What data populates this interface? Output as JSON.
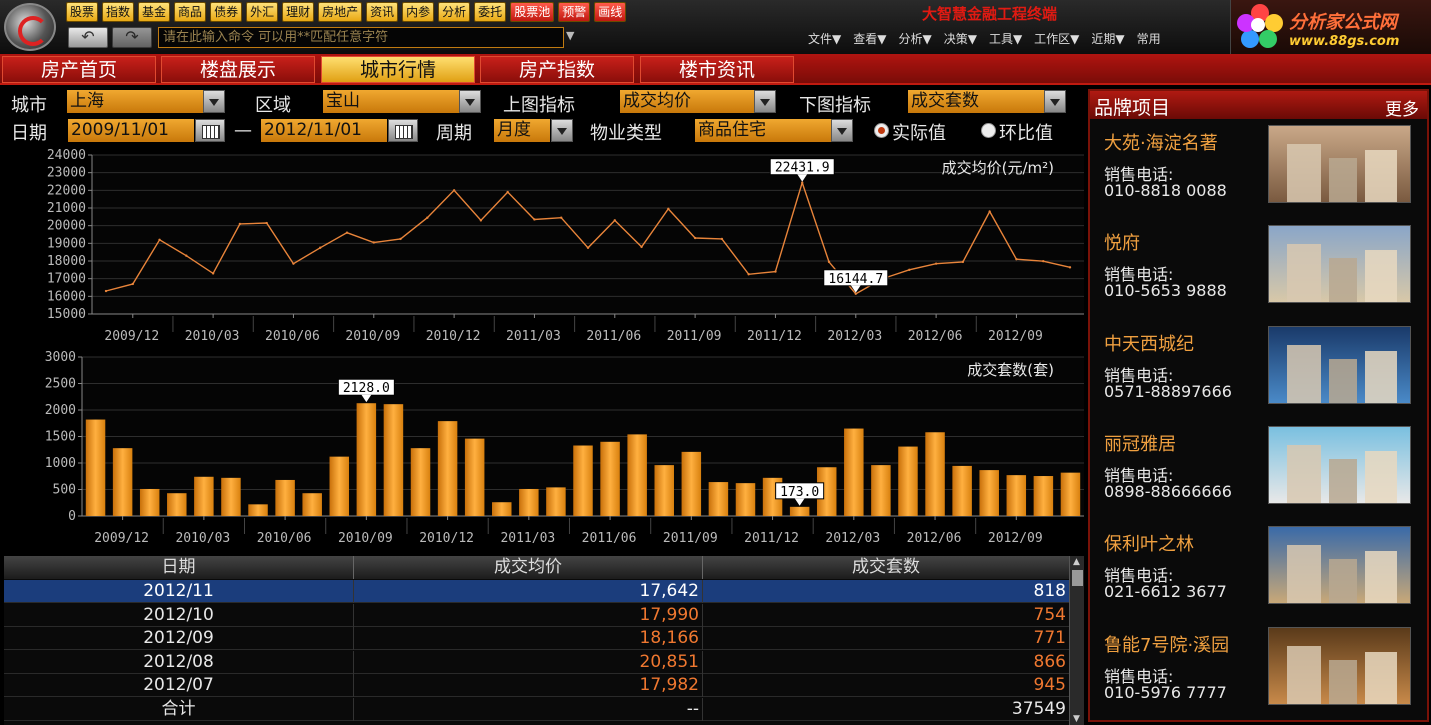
{
  "top_buttons": [
    "股票",
    "指数",
    "基金",
    "商品",
    "债券",
    "外汇",
    "理财",
    "房地产",
    "资讯",
    "内参",
    "分析",
    "委托",
    "股票池",
    "预警",
    "画线"
  ],
  "top_buttons_red": [
    12,
    13,
    14
  ],
  "app_title": "大智慧金融工程终端",
  "command": {
    "value": "请在此输入命令   可以用**匹配任意字符"
  },
  "menus": [
    "文件▼",
    "查看▼",
    "分析▼",
    "决策▼",
    "工具▼",
    "工作区▼",
    "近期▼",
    "常用"
  ],
  "brand": {
    "name": "分析家公式网",
    "url": "www.88gs.com"
  },
  "tabs": [
    "房产首页",
    "楼盘展示",
    "城市行情",
    "房产指数",
    "楼市资讯"
  ],
  "active_tab": 2,
  "filters": {
    "city_label": "城市",
    "city": "上海",
    "district_label": "区域",
    "district": "宝山",
    "upper_label": "上图指标",
    "upper": "成交均价",
    "lower_label": "下图指标",
    "lower": "成交套数",
    "date_label": "日期",
    "date_from": "2009/11/01",
    "date_sep": "—",
    "date_to": "2012/11/01",
    "period_label": "周期",
    "period": "月度",
    "type_label": "物业类型",
    "type": "商品住宅",
    "radio_actual": "实际值",
    "radio_mom": "环比值"
  },
  "chart_data": [
    {
      "type": "line",
      "title": "成交均价(元/m²)",
      "ylim": [
        15000,
        24000
      ],
      "yticks": [
        15000,
        16000,
        17000,
        18000,
        19000,
        20000,
        21000,
        22000,
        23000,
        24000
      ],
      "xticks": [
        "2009/12",
        "2010/03",
        "2010/06",
        "2010/09",
        "2010/12",
        "2011/03",
        "2011/06",
        "2011/09",
        "2011/12",
        "2012/03",
        "2012/06",
        "2012/09"
      ],
      "values": [
        16300,
        16700,
        19200,
        18300,
        17300,
        20100,
        20150,
        17850,
        18750,
        19600,
        19050,
        19250,
        20450,
        22000,
        20300,
        21900,
        20350,
        20450,
        18750,
        20300,
        18800,
        20950,
        19300,
        19250,
        17250,
        17400,
        22431.9,
        17950,
        16144.7,
        17000,
        17500,
        17850,
        17950,
        20800,
        18100,
        17990,
        17642
      ],
      "annotations": [
        {
          "index": 26,
          "label": "22431.9"
        },
        {
          "index": 28,
          "label": "16144.7"
        }
      ],
      "color": "#e8843a"
    },
    {
      "type": "bar",
      "title": "成交套数(套)",
      "ylim": [
        0,
        3000
      ],
      "yticks": [
        0,
        500,
        1000,
        1500,
        2000,
        2500,
        3000
      ],
      "xticks": [
        "2009/12",
        "2010/03",
        "2010/06",
        "2010/09",
        "2010/12",
        "2011/03",
        "2011/06",
        "2011/09",
        "2011/12",
        "2012/03",
        "2012/06",
        "2012/09"
      ],
      "values": [
        1820,
        1280,
        510,
        430,
        740,
        720,
        220,
        680,
        430,
        1120,
        2128,
        2110,
        1280,
        1790,
        1460,
        260,
        510,
        540,
        1330,
        1400,
        1540,
        960,
        1210,
        640,
        620,
        720,
        173,
        920,
        1650,
        960,
        1310,
        1580,
        945,
        866,
        771,
        754,
        818
      ],
      "annotations": [
        {
          "index": 10,
          "label": "2128.0"
        },
        {
          "index": 26,
          "label": "173.0"
        }
      ],
      "color": "#f0951a"
    }
  ],
  "table": {
    "headers": [
      "日期",
      "成交均价",
      "成交套数"
    ],
    "rows": [
      {
        "date": "2012/11",
        "price": "17,642",
        "count": "818"
      },
      {
        "date": "2012/10",
        "price": "17,990",
        "count": "754"
      },
      {
        "date": "2012/09",
        "price": "18,166",
        "count": "771"
      },
      {
        "date": "2012/08",
        "price": "20,851",
        "count": "866"
      },
      {
        "date": "2012/07",
        "price": "17,982",
        "count": "945"
      }
    ],
    "total": {
      "date": "合计",
      "price": "--",
      "count": "37549"
    }
  },
  "right_panel": {
    "title": "品牌项目",
    "more": "更多",
    "phone_label": "销售电话:",
    "items": [
      {
        "name": "大苑·海淀名著",
        "phone": "010-8818 0088"
      },
      {
        "name": "悦府",
        "phone": "010-5653 9888"
      },
      {
        "name": "中天西城纪",
        "phone": "0571-88897666"
      },
      {
        "name": "丽冠雅居",
        "phone": "0898-88666666"
      },
      {
        "name": "保利叶之林",
        "phone": "021-6612 3677"
      },
      {
        "name": "鲁能7号院·溪园",
        "phone": "010-5976 7777"
      }
    ]
  }
}
